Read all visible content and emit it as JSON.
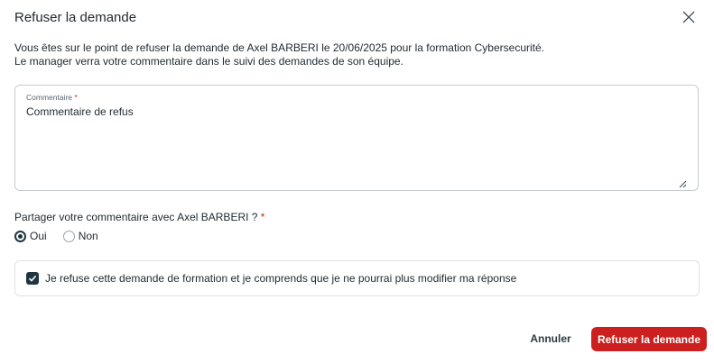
{
  "dialog": {
    "title": "Refuser la demande",
    "intro_line1": "Vous êtes sur le point de refuser la demande de Axel BARBERI le 20/06/2025 pour la formation Cybersecurité.",
    "intro_line2": "Le manager verra votre commentaire dans le suivi des demandes de son équipe."
  },
  "comment": {
    "label": "Commentaire",
    "required_mark": "*",
    "value": "Commentaire de refus"
  },
  "share": {
    "question": "Partager votre commentaire avec Axel BARBERI ?",
    "required_mark": "*",
    "options": [
      {
        "label": "Oui",
        "checked": true
      },
      {
        "label": "Non",
        "checked": false
      }
    ]
  },
  "confirm": {
    "text": "Je refuse cette demande de formation et je comprends que je ne pourrai plus modifier ma réponse",
    "checked": true
  },
  "actions": {
    "cancel_label": "Annuler",
    "refuse_label": "Refuser la demande"
  },
  "colors": {
    "primary_danger": "#cc1f1f",
    "checked_control": "#1f3540",
    "required": "#c62828"
  }
}
